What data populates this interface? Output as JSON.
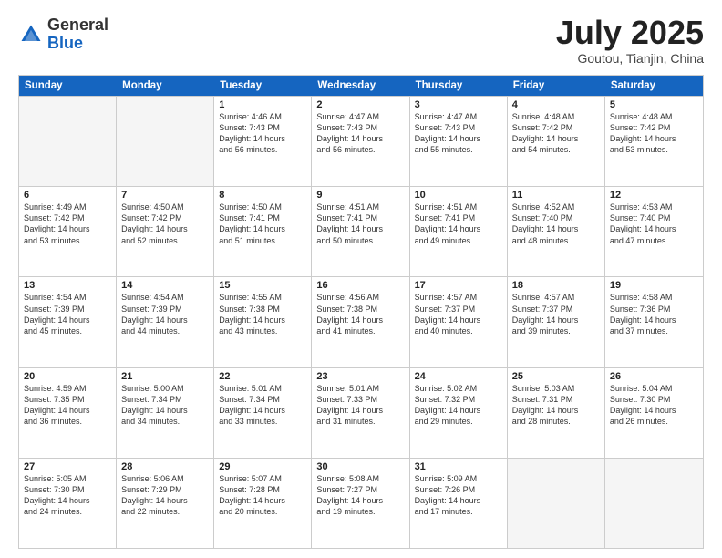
{
  "header": {
    "logo_general": "General",
    "logo_blue": "Blue",
    "month_title": "July 2025",
    "location": "Goutou, Tianjin, China"
  },
  "weekdays": [
    "Sunday",
    "Monday",
    "Tuesday",
    "Wednesday",
    "Thursday",
    "Friday",
    "Saturday"
  ],
  "rows": [
    [
      {
        "day": "",
        "info": "",
        "empty": true
      },
      {
        "day": "",
        "info": "",
        "empty": true
      },
      {
        "day": "1",
        "info": "Sunrise: 4:46 AM\nSunset: 7:43 PM\nDaylight: 14 hours\nand 56 minutes."
      },
      {
        "day": "2",
        "info": "Sunrise: 4:47 AM\nSunset: 7:43 PM\nDaylight: 14 hours\nand 56 minutes."
      },
      {
        "day": "3",
        "info": "Sunrise: 4:47 AM\nSunset: 7:43 PM\nDaylight: 14 hours\nand 55 minutes."
      },
      {
        "day": "4",
        "info": "Sunrise: 4:48 AM\nSunset: 7:42 PM\nDaylight: 14 hours\nand 54 minutes."
      },
      {
        "day": "5",
        "info": "Sunrise: 4:48 AM\nSunset: 7:42 PM\nDaylight: 14 hours\nand 53 minutes."
      }
    ],
    [
      {
        "day": "6",
        "info": "Sunrise: 4:49 AM\nSunset: 7:42 PM\nDaylight: 14 hours\nand 53 minutes."
      },
      {
        "day": "7",
        "info": "Sunrise: 4:50 AM\nSunset: 7:42 PM\nDaylight: 14 hours\nand 52 minutes."
      },
      {
        "day": "8",
        "info": "Sunrise: 4:50 AM\nSunset: 7:41 PM\nDaylight: 14 hours\nand 51 minutes."
      },
      {
        "day": "9",
        "info": "Sunrise: 4:51 AM\nSunset: 7:41 PM\nDaylight: 14 hours\nand 50 minutes."
      },
      {
        "day": "10",
        "info": "Sunrise: 4:51 AM\nSunset: 7:41 PM\nDaylight: 14 hours\nand 49 minutes."
      },
      {
        "day": "11",
        "info": "Sunrise: 4:52 AM\nSunset: 7:40 PM\nDaylight: 14 hours\nand 48 minutes."
      },
      {
        "day": "12",
        "info": "Sunrise: 4:53 AM\nSunset: 7:40 PM\nDaylight: 14 hours\nand 47 minutes."
      }
    ],
    [
      {
        "day": "13",
        "info": "Sunrise: 4:54 AM\nSunset: 7:39 PM\nDaylight: 14 hours\nand 45 minutes."
      },
      {
        "day": "14",
        "info": "Sunrise: 4:54 AM\nSunset: 7:39 PM\nDaylight: 14 hours\nand 44 minutes."
      },
      {
        "day": "15",
        "info": "Sunrise: 4:55 AM\nSunset: 7:38 PM\nDaylight: 14 hours\nand 43 minutes."
      },
      {
        "day": "16",
        "info": "Sunrise: 4:56 AM\nSunset: 7:38 PM\nDaylight: 14 hours\nand 41 minutes."
      },
      {
        "day": "17",
        "info": "Sunrise: 4:57 AM\nSunset: 7:37 PM\nDaylight: 14 hours\nand 40 minutes."
      },
      {
        "day": "18",
        "info": "Sunrise: 4:57 AM\nSunset: 7:37 PM\nDaylight: 14 hours\nand 39 minutes."
      },
      {
        "day": "19",
        "info": "Sunrise: 4:58 AM\nSunset: 7:36 PM\nDaylight: 14 hours\nand 37 minutes."
      }
    ],
    [
      {
        "day": "20",
        "info": "Sunrise: 4:59 AM\nSunset: 7:35 PM\nDaylight: 14 hours\nand 36 minutes."
      },
      {
        "day": "21",
        "info": "Sunrise: 5:00 AM\nSunset: 7:34 PM\nDaylight: 14 hours\nand 34 minutes."
      },
      {
        "day": "22",
        "info": "Sunrise: 5:01 AM\nSunset: 7:34 PM\nDaylight: 14 hours\nand 33 minutes."
      },
      {
        "day": "23",
        "info": "Sunrise: 5:01 AM\nSunset: 7:33 PM\nDaylight: 14 hours\nand 31 minutes."
      },
      {
        "day": "24",
        "info": "Sunrise: 5:02 AM\nSunset: 7:32 PM\nDaylight: 14 hours\nand 29 minutes."
      },
      {
        "day": "25",
        "info": "Sunrise: 5:03 AM\nSunset: 7:31 PM\nDaylight: 14 hours\nand 28 minutes."
      },
      {
        "day": "26",
        "info": "Sunrise: 5:04 AM\nSunset: 7:30 PM\nDaylight: 14 hours\nand 26 minutes."
      }
    ],
    [
      {
        "day": "27",
        "info": "Sunrise: 5:05 AM\nSunset: 7:30 PM\nDaylight: 14 hours\nand 24 minutes."
      },
      {
        "day": "28",
        "info": "Sunrise: 5:06 AM\nSunset: 7:29 PM\nDaylight: 14 hours\nand 22 minutes."
      },
      {
        "day": "29",
        "info": "Sunrise: 5:07 AM\nSunset: 7:28 PM\nDaylight: 14 hours\nand 20 minutes."
      },
      {
        "day": "30",
        "info": "Sunrise: 5:08 AM\nSunset: 7:27 PM\nDaylight: 14 hours\nand 19 minutes."
      },
      {
        "day": "31",
        "info": "Sunrise: 5:09 AM\nSunset: 7:26 PM\nDaylight: 14 hours\nand 17 minutes."
      },
      {
        "day": "",
        "info": "",
        "empty": true
      },
      {
        "day": "",
        "info": "",
        "empty": true
      }
    ]
  ]
}
